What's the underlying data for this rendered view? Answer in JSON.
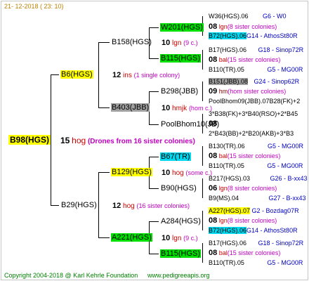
{
  "header": {
    "date": "21- 12-2018 ( 23: 10)"
  },
  "footer": {
    "copyright": "Copyright 2004-2018 @ Karl Kehrle Foundation",
    "site": "www.pedigreeapis.org"
  },
  "root": {
    "label": "B98(HGS)",
    "num": "15",
    "abbr": "hog",
    "note": "(Drones from 16 sister colonies)"
  },
  "gen1": {
    "top": {
      "label": "B6(HGS)",
      "num": "12",
      "abbr": "ins",
      "note": "(1 single colony)"
    },
    "bottom": {
      "label": "B29(HGS)",
      "num": "12",
      "abbr": "hog",
      "note": "(16 sister colonies)"
    }
  },
  "gen2": {
    "a": {
      "label": "B158(HGS)",
      "num": "10",
      "abbr": "lgn",
      "note": "(9 c.)"
    },
    "b": {
      "label": "B403(JBB)",
      "num": "10",
      "abbr": "hmjk",
      "note": "(hom c.)"
    },
    "c": {
      "label": "B129(HGS)",
      "num": "10",
      "abbr": "hog",
      "note": "(some c.)"
    },
    "d": {
      "label": "A221(HGS)",
      "num": "10",
      "abbr": "lgn",
      "note": "(9 c.)"
    }
  },
  "gen3": {
    "w201": "W201(HGS)",
    "b115a": "B115(HGS)",
    "b298": "B298(JBB)",
    "poolbhom10": "PoolBhom10(JB)",
    "b67": "B67(TR)",
    "b90": "B90(HGS)",
    "a284": "A284(HGS)",
    "b115b": "B115(HGS)"
  },
  "gen4": [
    {
      "a": "W36(HGS).06",
      "b": "G6 - W0"
    },
    {
      "num": "08",
      "abbr": "lgn",
      "note": "(8 sister colonies)"
    },
    {
      "a": "B72(HGS).06",
      "b": "G14 - AthosSt80R"
    },
    {
      "a": "B17(HGS).06",
      "b": "G18 - Sinop72R"
    },
    {
      "num": "08",
      "abbr": "bal",
      "note": "(15 sister colonies)"
    },
    {
      "a": "B110(TR).05",
      "b": "G5 - MG00R"
    },
    {
      "a": "B151(JBB).08",
      "b": "G24 - Sinop62R"
    },
    {
      "num": "09",
      "abbr": "hm",
      "note": "(hom sister colonies)"
    },
    {
      "a": "PoolBhom09(JBB).07",
      "b": "B28(FK)+2"
    },
    {
      "a": "3*B38(FK)+3*B40(RSO)+2*B45",
      "b": ""
    },
    {
      "num": "08",
      "abbr": "",
      "note": ""
    },
    {
      "a": "2*B43(BB)+2*B20(AKB)+3*B3",
      "b": ""
    },
    {
      "a": "B130(TR).06",
      "b": "G5 - MG00R"
    },
    {
      "num": "08",
      "abbr": "bal",
      "note": "(15 sister colonies)"
    },
    {
      "a": "B110(TR).05",
      "b": "G5 - MG00R"
    },
    {
      "a": "B217(HGS).03",
      "b": "G26 - B-xx43"
    },
    {
      "num": "06",
      "abbr": "lgn",
      "note": "(8 sister colonies)"
    },
    {
      "a": "B9(MS).04",
      "b": "G27 - B-xx43"
    },
    {
      "a": "A227(HGS).07",
      "b": "G2 - Bozdag07R"
    },
    {
      "num": "08",
      "abbr": "lgn",
      "note": "(8 sister colonies)"
    },
    {
      "a": "B72(HGS).06",
      "b": "G14 - AthosSt80R"
    },
    {
      "a": "B17(HGS).06",
      "b": "G18 - Sinop72R"
    },
    {
      "num": "08",
      "abbr": "bal",
      "note": "(15 sister colonies)"
    },
    {
      "a": "B110(TR).05",
      "b": "G5 - MG00R"
    }
  ]
}
